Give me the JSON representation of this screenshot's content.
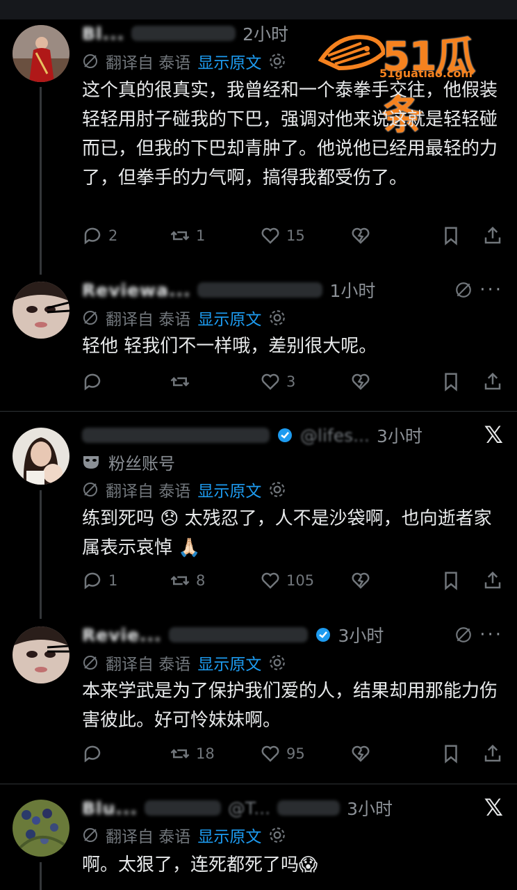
{
  "translate": {
    "from_text": "翻译自 泰语",
    "show_original": "显示原文"
  },
  "watermark": {
    "brand": "51瓜条",
    "url": "51guatiao.com"
  },
  "tweets": [
    {
      "name": "Bl...",
      "handle": "",
      "time": "2小时",
      "text": "这个真的很真实，我曾经和一个泰拳手交往，他假装轻轻用肘子碰我的下巴，强调对他来说这就是轻轻碰而已，但我的下巴却青肿了。他说他已经用最轻的力了，但拳手的力气啊，搞得我都受伤了。",
      "replies": "2",
      "reposts": "1",
      "likes": "15"
    },
    {
      "name": "Reviewa...",
      "handle": "",
      "time": "1小时",
      "text": "轻他 轻我们不一样哦，差别很大呢。",
      "replies": "",
      "reposts": "",
      "likes": "3"
    },
    {
      "name": "...",
      "handle": "@lifes...",
      "time": "3小时",
      "fan_label": "粉丝账号",
      "text": "练到死吗 😞 太残忍了，人不是沙袋啊，也向逝者家属表示哀悼 🙏🏻",
      "replies": "1",
      "reposts": "8",
      "likes": "105"
    },
    {
      "name": "Revie...",
      "handle": "",
      "time": "3小时",
      "text": "本来学武是为了保护我们爱的人，结果却用那能力伤害彼此。好可怜妹妹啊。",
      "replies": "",
      "reposts": "18",
      "likes": "95"
    },
    {
      "name": "Blu...",
      "handle": "@T...",
      "time": "3小时",
      "text": "啊。太狠了，连死都死了吗😱",
      "replies": "",
      "reposts": "",
      "likes": ""
    }
  ],
  "colors": {
    "background": "#000000",
    "link": "#1d9bf0",
    "muted": "#71767b",
    "verified": "#1d9bf0",
    "watermark": "#f5821f"
  }
}
